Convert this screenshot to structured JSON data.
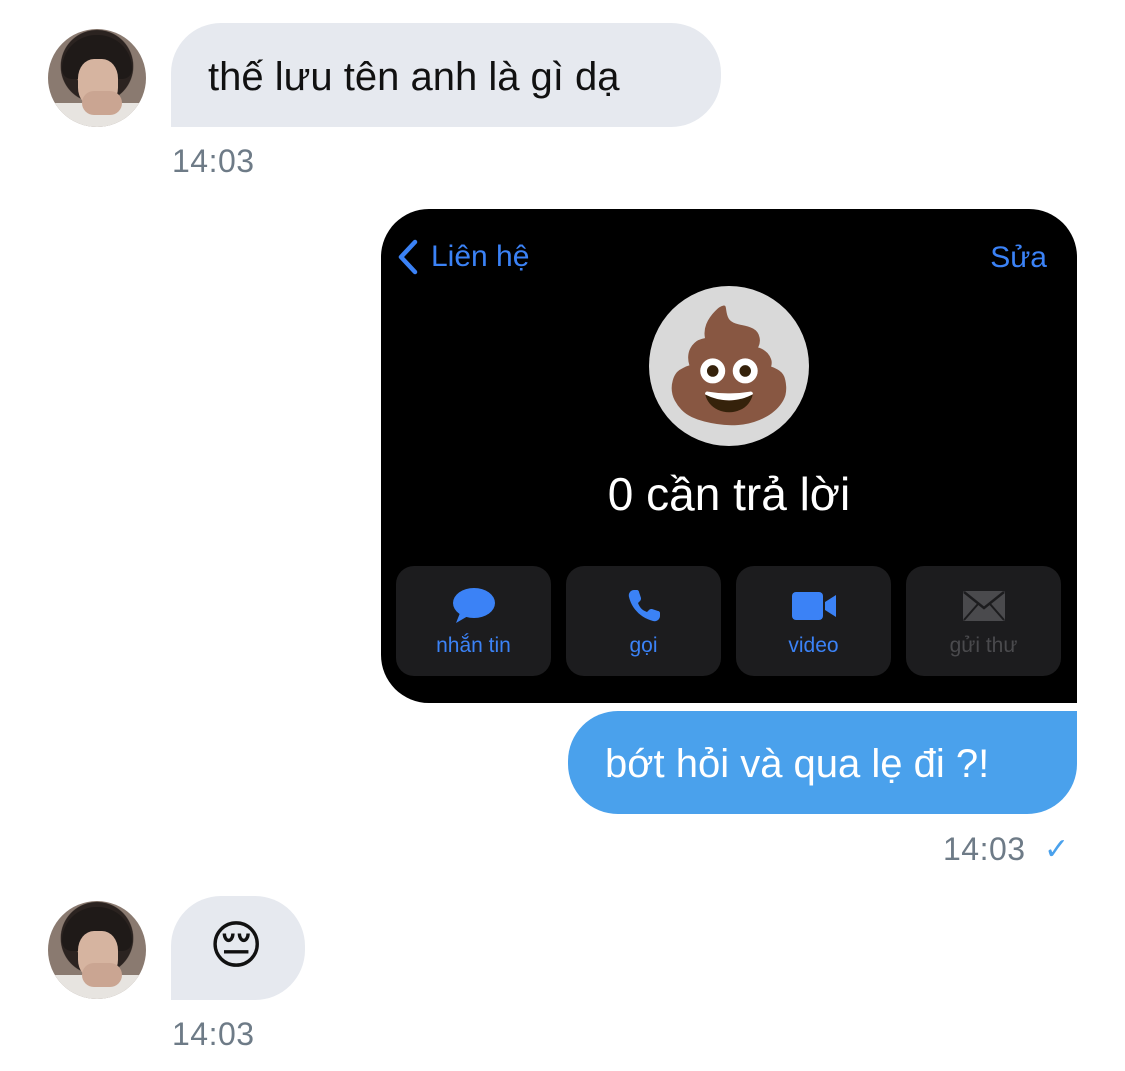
{
  "messages": [
    {
      "direction": "in",
      "text": "thế lưu tên anh là gì dạ",
      "time": "14:03"
    },
    {
      "direction": "out",
      "contact_card": {
        "back_label": "Liên hệ",
        "edit_label": "Sửa",
        "contact_name": "0 cần trả lời",
        "photo_emoji": "💩",
        "actions": [
          {
            "label": "nhắn tin",
            "icon": "message-bubble-icon",
            "enabled": true
          },
          {
            "label": "gọi",
            "icon": "phone-icon",
            "enabled": true
          },
          {
            "label": "video",
            "icon": "video-camera-icon",
            "enabled": true
          },
          {
            "label": "gửi thư",
            "icon": "mail-envelope-icon",
            "enabled": false
          }
        ]
      }
    },
    {
      "direction": "out",
      "text": "bớt hỏi và qua lẹ đi ?!",
      "time": "14:03",
      "status": "✓"
    },
    {
      "direction": "in",
      "text": "😔",
      "time": "14:03"
    }
  ],
  "colors": {
    "incoming_bubble": "#e6e9ef",
    "outgoing_bubble": "#4aa1ec",
    "timestamp": "#6e7b87",
    "ios_link_blue": "#3b82f6",
    "card_background": "#000000"
  }
}
